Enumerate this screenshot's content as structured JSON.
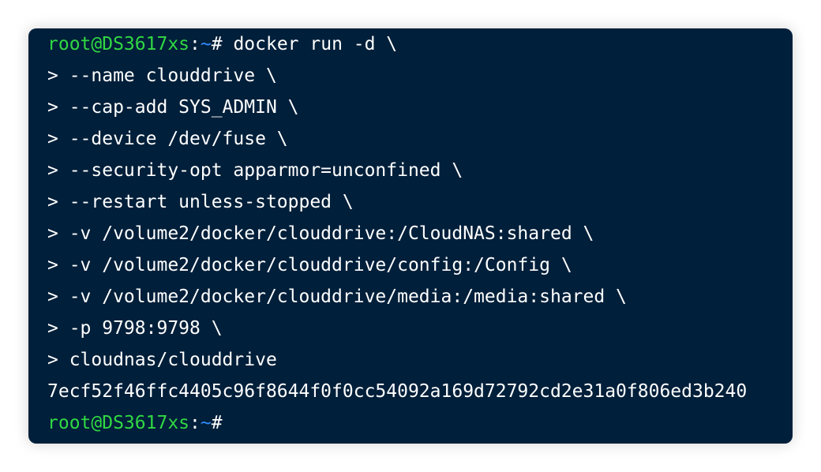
{
  "terminal": {
    "prompt_user": "root@DS3617xs",
    "prompt_colon": ":",
    "prompt_path": "~",
    "prompt_hash": "#",
    "command": " docker run -d \\",
    "continuation_lines": [
      "> --name clouddrive \\",
      "> --cap-add SYS_ADMIN \\",
      "> --device /dev/fuse \\",
      "> --security-opt apparmor=unconfined \\",
      "> --restart unless-stopped \\",
      "> -v /volume2/docker/clouddrive:/CloudNAS:shared \\",
      "> -v /volume2/docker/clouddrive/config:/Config \\",
      "> -v /volume2/docker/clouddrive/media:/media:shared \\",
      "> -p 9798:9798 \\",
      "> cloudnas/clouddrive"
    ],
    "output": "7ecf52f46ffc4405c96f8644f0f0cc54092a169d72792cd2e31a0f806ed3b240",
    "colors": {
      "background": "#001f3a",
      "user": "#31d843",
      "path": "#2f8cff",
      "text": "#ffffff"
    }
  }
}
